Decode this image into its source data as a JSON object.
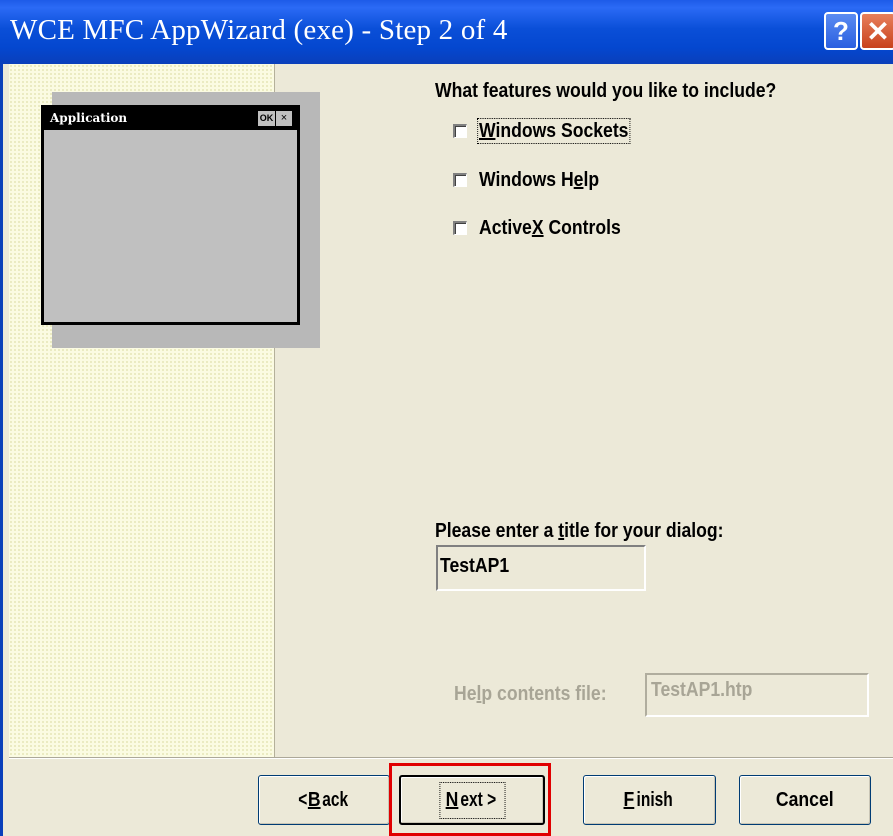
{
  "window": {
    "title": "WCE MFC AppWizard (exe) - Step 2 of 4",
    "help_glyph": "?",
    "close_glyph": "✕"
  },
  "preview": {
    "title": "Application",
    "ok_label": "OK",
    "close_glyph": "×"
  },
  "features": {
    "question": "What features would you like to include?",
    "options": [
      {
        "label_pre": "",
        "label_key": "W",
        "label_post": "indows Sockets",
        "checked": false
      },
      {
        "label_pre": "Windows H",
        "label_key": "e",
        "label_post": "lp",
        "checked": false
      },
      {
        "label_pre": "Active",
        "label_key": "X",
        "label_post": " Controls",
        "checked": false
      }
    ]
  },
  "dialog_title": {
    "prompt_pre": "Please enter a ",
    "prompt_key": "t",
    "prompt_post": "itle for your dialog:",
    "value": "TestAP1"
  },
  "help_file": {
    "label_pre": "He",
    "label_key": "l",
    "label_post": "p contents file:",
    "value": "TestAP1.htp"
  },
  "buttons": {
    "back_pre": "< ",
    "back_key": "B",
    "back_post": "ack",
    "next_key": "N",
    "next_post": "ext >",
    "finish_key": "F",
    "finish_post": "inish",
    "cancel": "Cancel"
  },
  "colors": {
    "titlebar": "#0447cf",
    "highlight": "#e00000",
    "face": "#ece9d8"
  }
}
